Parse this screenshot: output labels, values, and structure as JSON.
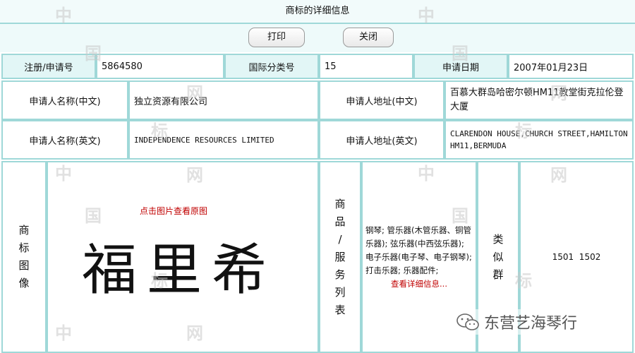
{
  "header": {
    "title": "商标的详细信息"
  },
  "toolbar": {
    "print_label": "打印",
    "close_label": "关闭"
  },
  "reg": {
    "reg_no_label": "注册/申请号",
    "reg_no": "5864580",
    "class_label": "国际分类号",
    "class_no": "15",
    "date_label": "申请日期",
    "date": "2007年01月23日"
  },
  "applicant": {
    "name_cn_label": "申请人名称(中文)",
    "name_cn": "独立资源有限公司",
    "addr_cn_label": "申请人地址(中文)",
    "addr_cn": "百慕大群岛哈密尔顿HM11教堂街克拉伦登大厦",
    "name_en_label": "申请人名称(英文)",
    "name_en": "INDEPENDENCE RESOURCES LIMITED",
    "addr_en_label": "申请人地址(英文)",
    "addr_en": "CLARENDON HOUSE,CHURCH STREET,HAMILTON HM11,BERMUDA"
  },
  "mark": {
    "image_label": [
      "商",
      "标",
      "图",
      "像"
    ],
    "click_hint": "点击图片查看原图",
    "mark_text": "福里希"
  },
  "goods": {
    "label": [
      "商",
      "品",
      "/",
      "服",
      "务",
      "列",
      "表"
    ],
    "text": "钢琴; 管乐器(木管乐器、铜管乐器); 弦乐器(中西弦乐器); 电子乐器(电子琴、电子钢琴); 打击乐器; 乐器配件;",
    "detail_link": "查看详细信息..."
  },
  "similar": {
    "label": [
      "类",
      "似",
      "群"
    ],
    "groups": "1501  1502"
  },
  "watermark": {
    "chars": [
      "中",
      "国",
      "网",
      "标"
    ],
    "account": "东营艺海琴行"
  },
  "icons": {
    "wechat": "wechat-icon"
  }
}
